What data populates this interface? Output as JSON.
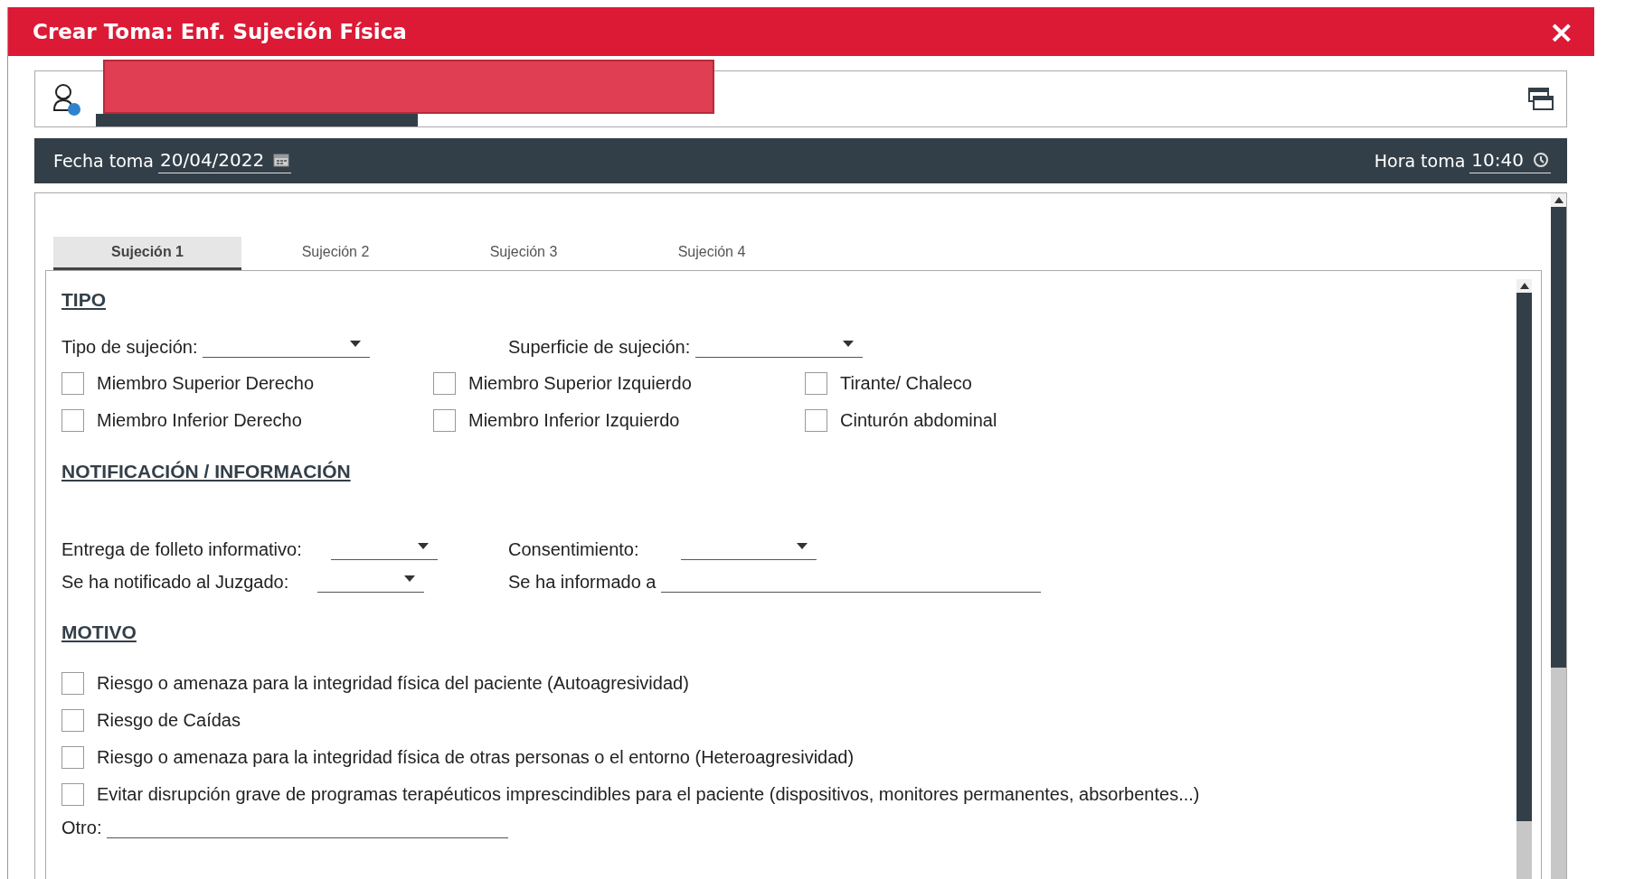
{
  "window": {
    "title": "Crear Toma: Enf. Sujeción Física",
    "close": "×"
  },
  "header": {
    "date_label": "Fecha toma",
    "date": "20/04/2022",
    "time_label": "Hora toma",
    "time": "10:40"
  },
  "tabs": [
    {
      "label": "Sujeción 1",
      "selected": true
    },
    {
      "label": "Sujeción 2",
      "selected": false
    },
    {
      "label": "Sujeción 3",
      "selected": false
    },
    {
      "label": "Sujeción 4",
      "selected": false
    }
  ],
  "sections": [
    {
      "title": "TIPO",
      "rows": [
        {
          "kind": "fields",
          "items": [
            {
              "kind": "select",
              "label": "Tipo de sujeción:"
            },
            {
              "kind": "select",
              "label": "Superficie de sujeción:"
            }
          ]
        },
        {
          "kind": "checks",
          "items": [
            {
              "label": "Miembro Superior Derecho",
              "checked": false
            },
            {
              "label": "Miembro Superior Izquierdo",
              "checked": false
            },
            {
              "label": "Tirante/ Chaleco",
              "checked": false
            }
          ]
        },
        {
          "kind": "checks",
          "items": [
            {
              "label": "Miembro Inferior Derecho",
              "checked": false
            },
            {
              "label": "Miembro Inferior Izquierdo",
              "checked": false
            },
            {
              "label": "Cinturón abdominal",
              "checked": false
            }
          ]
        }
      ]
    },
    {
      "title": "NOTIFICACIÓN / INFORMACIÓN",
      "rows": [
        {
          "kind": "fields",
          "items": [
            {
              "kind": "select",
              "label": "Entrega de folleto informativo:"
            },
            {
              "kind": "select",
              "label": "Consentimiento:"
            }
          ]
        },
        {
          "kind": "fields",
          "items": [
            {
              "kind": "select",
              "label": "Se ha notificado al Juzgado:"
            },
            {
              "kind": "text",
              "label": "Se ha informado a"
            }
          ]
        }
      ]
    },
    {
      "title": "MOTIVO",
      "rows": [
        {
          "kind": "check",
          "items": [
            {
              "label": "Riesgo o amenaza para la integridad física del paciente (Autoagresividad)",
              "checked": false
            }
          ]
        },
        {
          "kind": "check",
          "items": [
            {
              "label": "Riesgo de Caídas",
              "checked": false
            }
          ]
        },
        {
          "kind": "check",
          "items": [
            {
              "label": "Riesgo o amenaza para la integridad física de otras personas o el entorno (Heteroagresividad)",
              "checked": false
            }
          ]
        },
        {
          "kind": "check",
          "items": [
            {
              "label": "Evitar disrupción grave de programas terapéuticos imprescindibles para el paciente (dispositivos, monitores permanentes, absorbentes...)",
              "checked": false
            }
          ]
        },
        {
          "kind": "fields",
          "items": [
            {
              "kind": "other",
              "label": "Otro:"
            }
          ]
        }
      ]
    }
  ]
}
